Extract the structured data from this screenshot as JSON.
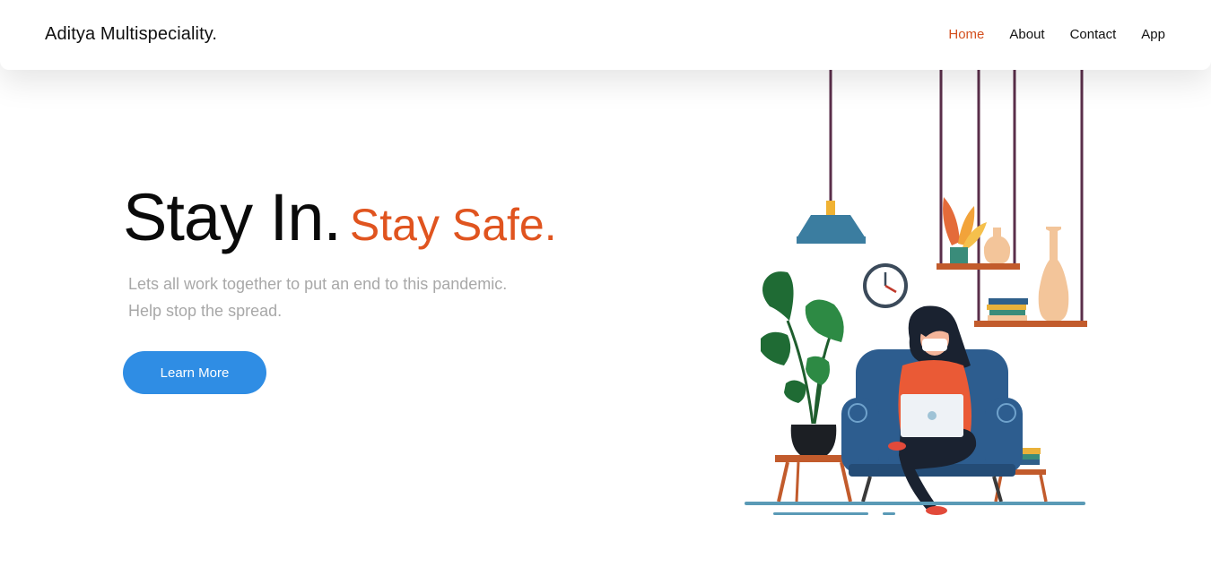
{
  "brand": "Aditya Multispeciality.",
  "nav": {
    "items": [
      "Home",
      "About",
      "Contact",
      "App"
    ],
    "active": "Home"
  },
  "hero": {
    "title_primary": "Stay In.",
    "title_accent": "Stay Safe.",
    "subtitle_line1": "Lets all work together to put an end to this pandemic.",
    "subtitle_line2": "Help stop the spread.",
    "cta_label": "Learn More"
  },
  "colors": {
    "accent": "#e0541f",
    "button": "#2f8de4",
    "subtitle": "#a8a8a8"
  }
}
